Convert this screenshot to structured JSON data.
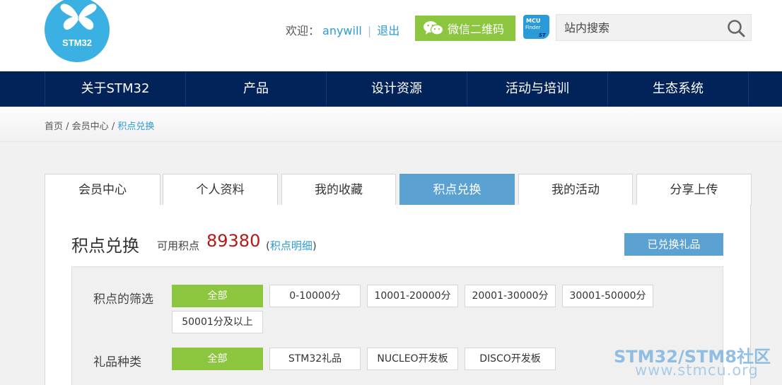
{
  "logo": {
    "text": "STM32",
    "color": "#3bb0e3"
  },
  "header": {
    "welcome_label": "欢迎：",
    "username": "anywill",
    "separator": "|",
    "logout_label": "退出",
    "wechat_label": "微信二维码",
    "mcu_finder_label": "MCU Finder",
    "search": {
      "placeholder": "站内搜索",
      "value": ""
    }
  },
  "nav": {
    "items": [
      {
        "label": "关于STM32"
      },
      {
        "label": "产品"
      },
      {
        "label": "设计资源"
      },
      {
        "label": "活动与培训"
      },
      {
        "label": "生态系统"
      }
    ]
  },
  "breadcrumb": {
    "items": [
      "首页",
      "会员中心",
      "积点兑换"
    ],
    "separator": " / "
  },
  "tabs": [
    {
      "label": "会员中心",
      "active": false
    },
    {
      "label": "个人资料",
      "active": false
    },
    {
      "label": "我的收藏",
      "active": false
    },
    {
      "label": "积点兑换",
      "active": true
    },
    {
      "label": "我的活动",
      "active": false
    },
    {
      "label": "分享上传",
      "active": false
    }
  ],
  "points": {
    "title": "积点兑换",
    "available_label": "可用积点",
    "value": "89380",
    "detail_open": "(",
    "detail_link": "积点明细",
    "detail_close": ")",
    "redeemed_label": "已兑换礼品"
  },
  "filters": {
    "points_filter": {
      "label": "积点的筛选",
      "options": [
        "全部",
        "0-10000分",
        "10001-20000分",
        "20001-30000分",
        "30001-50000分",
        "50001分及以上"
      ],
      "selected": "全部"
    },
    "gift_category": {
      "label": "礼品种类",
      "options": [
        "全部",
        "STM32礼品",
        "NUCLEO开发板",
        "DISCO开发板"
      ],
      "selected": "全部"
    }
  },
  "watermark": {
    "line1": "STM32/STM8社区",
    "line2": "www.stmcu.org"
  },
  "colors": {
    "nav_bg": "#022359",
    "accent_blue": "#5ba2d3",
    "accent_green": "#8cc63f",
    "link_blue": "#2a9bd8",
    "points_red": "#b41919"
  }
}
